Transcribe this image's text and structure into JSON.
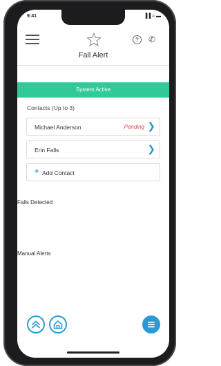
{
  "status_bar": {
    "time": "9:41",
    "icons": "▐▐ ≈ ▬"
  },
  "nav": {
    "menu_icon": "hamburger-menu-icon",
    "logo_icon": "star-logo-icon",
    "help_icon": "help-icon",
    "help_glyph": "?",
    "phone_icon": "phone-icon",
    "phone_glyph": "✆"
  },
  "page": {
    "title": "Fall Alert"
  },
  "banner": {
    "text": "System Active",
    "color": "#2fc99a"
  },
  "contacts": {
    "heading": "Contacts (Up to 3)",
    "items": [
      {
        "name": "Michael Anderson",
        "status": "Pending"
      },
      {
        "name": "Erin Falls",
        "status": ""
      }
    ],
    "add_plus": "+",
    "add_label": "Add Contact"
  },
  "sections": {
    "falls_detected": "Falls Detected",
    "manual_alerts": "Manual Alerts"
  },
  "bottom_bar": {
    "scroll_top_icon": "double-chevron-up-icon",
    "home_icon": "home-icon",
    "list_icon": "list-icon"
  },
  "colors": {
    "accent": "#2b9ad6",
    "pending": "#e0445a"
  }
}
